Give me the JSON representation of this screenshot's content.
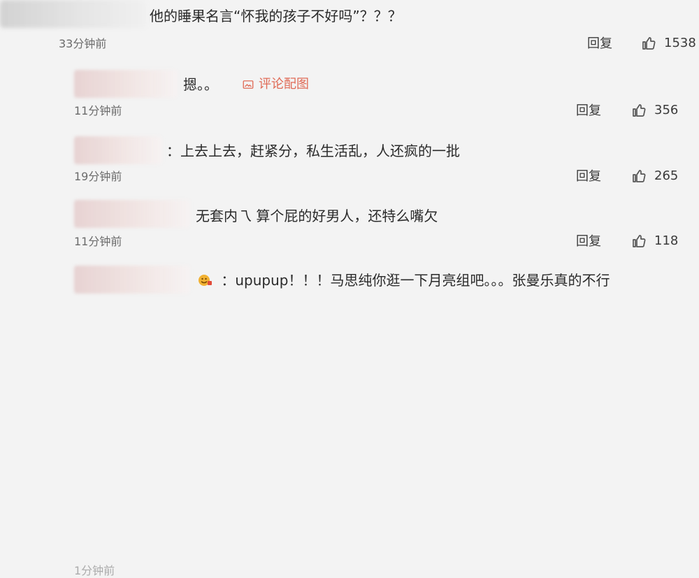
{
  "comments": [
    {
      "text": "他的睡果名言“怀我的孩子不好吗”？？？",
      "time": "33分钟前",
      "reply": "回复",
      "likes": "1538"
    },
    {
      "text": "摁。。",
      "time": "11分钟前",
      "reply": "回复",
      "likes": "356",
      "pic_link": "评论配图"
    },
    {
      "text": "：上去上去，赶紧分，私生活乱，人还疯的一批",
      "time": "19分钟前",
      "reply": "回复",
      "likes": "265"
    },
    {
      "text": "无套内乁 算个屁的好男人，还特么嘴欠",
      "time": "11分钟前",
      "reply": "回复",
      "likes": "118"
    },
    {
      "text": "：upupup！！！马思纯你逛一下月亮组吧。。。张曼乐真的不行",
      "time": "1分钟前"
    }
  ],
  "icons": {
    "thumb": "thumb-up-icon",
    "picture": "picture-icon",
    "emoji": "emoji-icon"
  },
  "colors": {
    "background": "#f3f3f3",
    "link": "#e06b57",
    "text": "#2a2a2a",
    "muted": "#6b6b6b"
  }
}
